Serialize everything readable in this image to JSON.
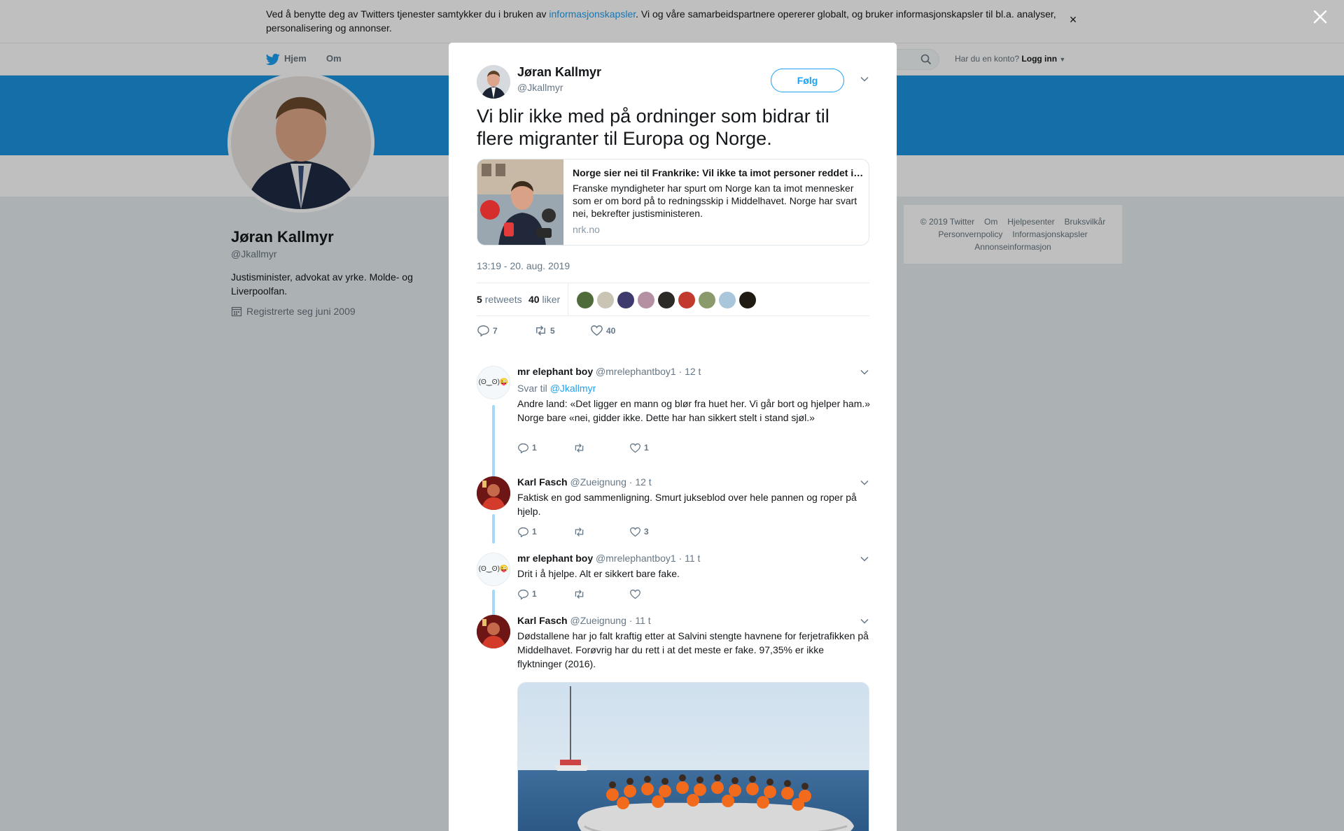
{
  "cookie_banner": {
    "text_before": "Ved å benytte deg av Twitters tjenester samtykker du i bruken av ",
    "link": "informasjonskapsler",
    "text_after": ". Vi og våre samarbeidspartnere opererer globalt, og bruker informasjonskapsler til bl.a. analyser, personalisering og annonser.",
    "close": "×"
  },
  "nav": {
    "home": "Hjem",
    "about": "Om",
    "account_prompt": "Har du en konto?",
    "login": "Logg inn"
  },
  "profile": {
    "name": "Jøran Kallmyr",
    "handle": "@Jkallmyr",
    "bio": "Justisminister, advokat av yrke. Molde- og Liverpoolfan.",
    "joined": "Registrerte seg juni 2009"
  },
  "footer": {
    "links": [
      "© 2019 Twitter",
      "Om",
      "Hjelpesenter",
      "Bruksvilkår",
      "Personvernpolicy",
      "Informasjonskapsler",
      "Annonseinformasjon"
    ]
  },
  "tweet": {
    "author_name": "Jøran Kallmyr",
    "author_handle": "@Jkallmyr",
    "follow_label": "Følg",
    "text": "Vi blir ikke med på ordninger som bidrar til flere migranter til Europa og Norge.",
    "card": {
      "title": "Norge sier nei til Frankrike: Vil ikke ta imot personer reddet i Middelhavet",
      "description": "Franske myndigheter har spurt om Norge kan ta imot mennesker som er om bord på to redningsskip i Middelhavet. Norge har svart nei, bekrefter justisministeren.",
      "domain": "nrk.no"
    },
    "timestamp": "13:19 - 20. aug. 2019",
    "retweets_count": "5",
    "retweets_label": "retweets",
    "likes_count": "40",
    "likes_label": "liker",
    "reply_count": "7",
    "retweet_count_action": "5",
    "like_count_action": "40"
  },
  "replies": [
    {
      "name": "mr elephant boy",
      "handle": "@mrelephantboy1",
      "time": "· 12 t",
      "reply_to_label": "Svar til",
      "reply_to_handle": "@Jkallmyr",
      "avatar_text": "(ʘ‿ʘ)😜",
      "text_line1": "Andre land: «Det ligger en mann og blør fra huet her. Vi går bort og hjelper ham.»",
      "text_line2": "Norge bare «nei, gidder ikke. Dette har han sikkert stelt i stand sjøl.»",
      "replies": "1",
      "retweets": "",
      "likes": "1"
    },
    {
      "name": "Karl Fasch",
      "handle": "@Zueignung",
      "time": "· 12 t",
      "text": "Faktisk en god sammenligning. Smurt jukseblod over hele pannen og roper på hjelp.",
      "replies": "1",
      "retweets": "",
      "likes": "3"
    },
    {
      "name": "mr elephant boy",
      "handle": "@mrelephantboy1",
      "time": "· 11 t",
      "avatar_text": "(ʘ‿ʘ)😜",
      "text": "Drit i å hjelpe. Alt er sikkert bare fake.",
      "replies": "1",
      "retweets": "",
      "likes": ""
    },
    {
      "name": "Karl Fasch",
      "handle": "@Zueignung",
      "time": "· 11 t",
      "text": "Dødstallene har jo falt kraftig etter at Salvini stengte havnene for ferjetrafikken på Middelhavet. Forøvrig har du rett i at det meste er fake. 97,35% er ikke flyktninger (2016).",
      "replies": "",
      "retweets": "",
      "likes": ""
    }
  ],
  "colors": {
    "twitter_blue": "#1da1f2",
    "banner_blue": "#1b95e0",
    "thread_line": "#a4d9f9",
    "secondary_text": "#657786"
  }
}
